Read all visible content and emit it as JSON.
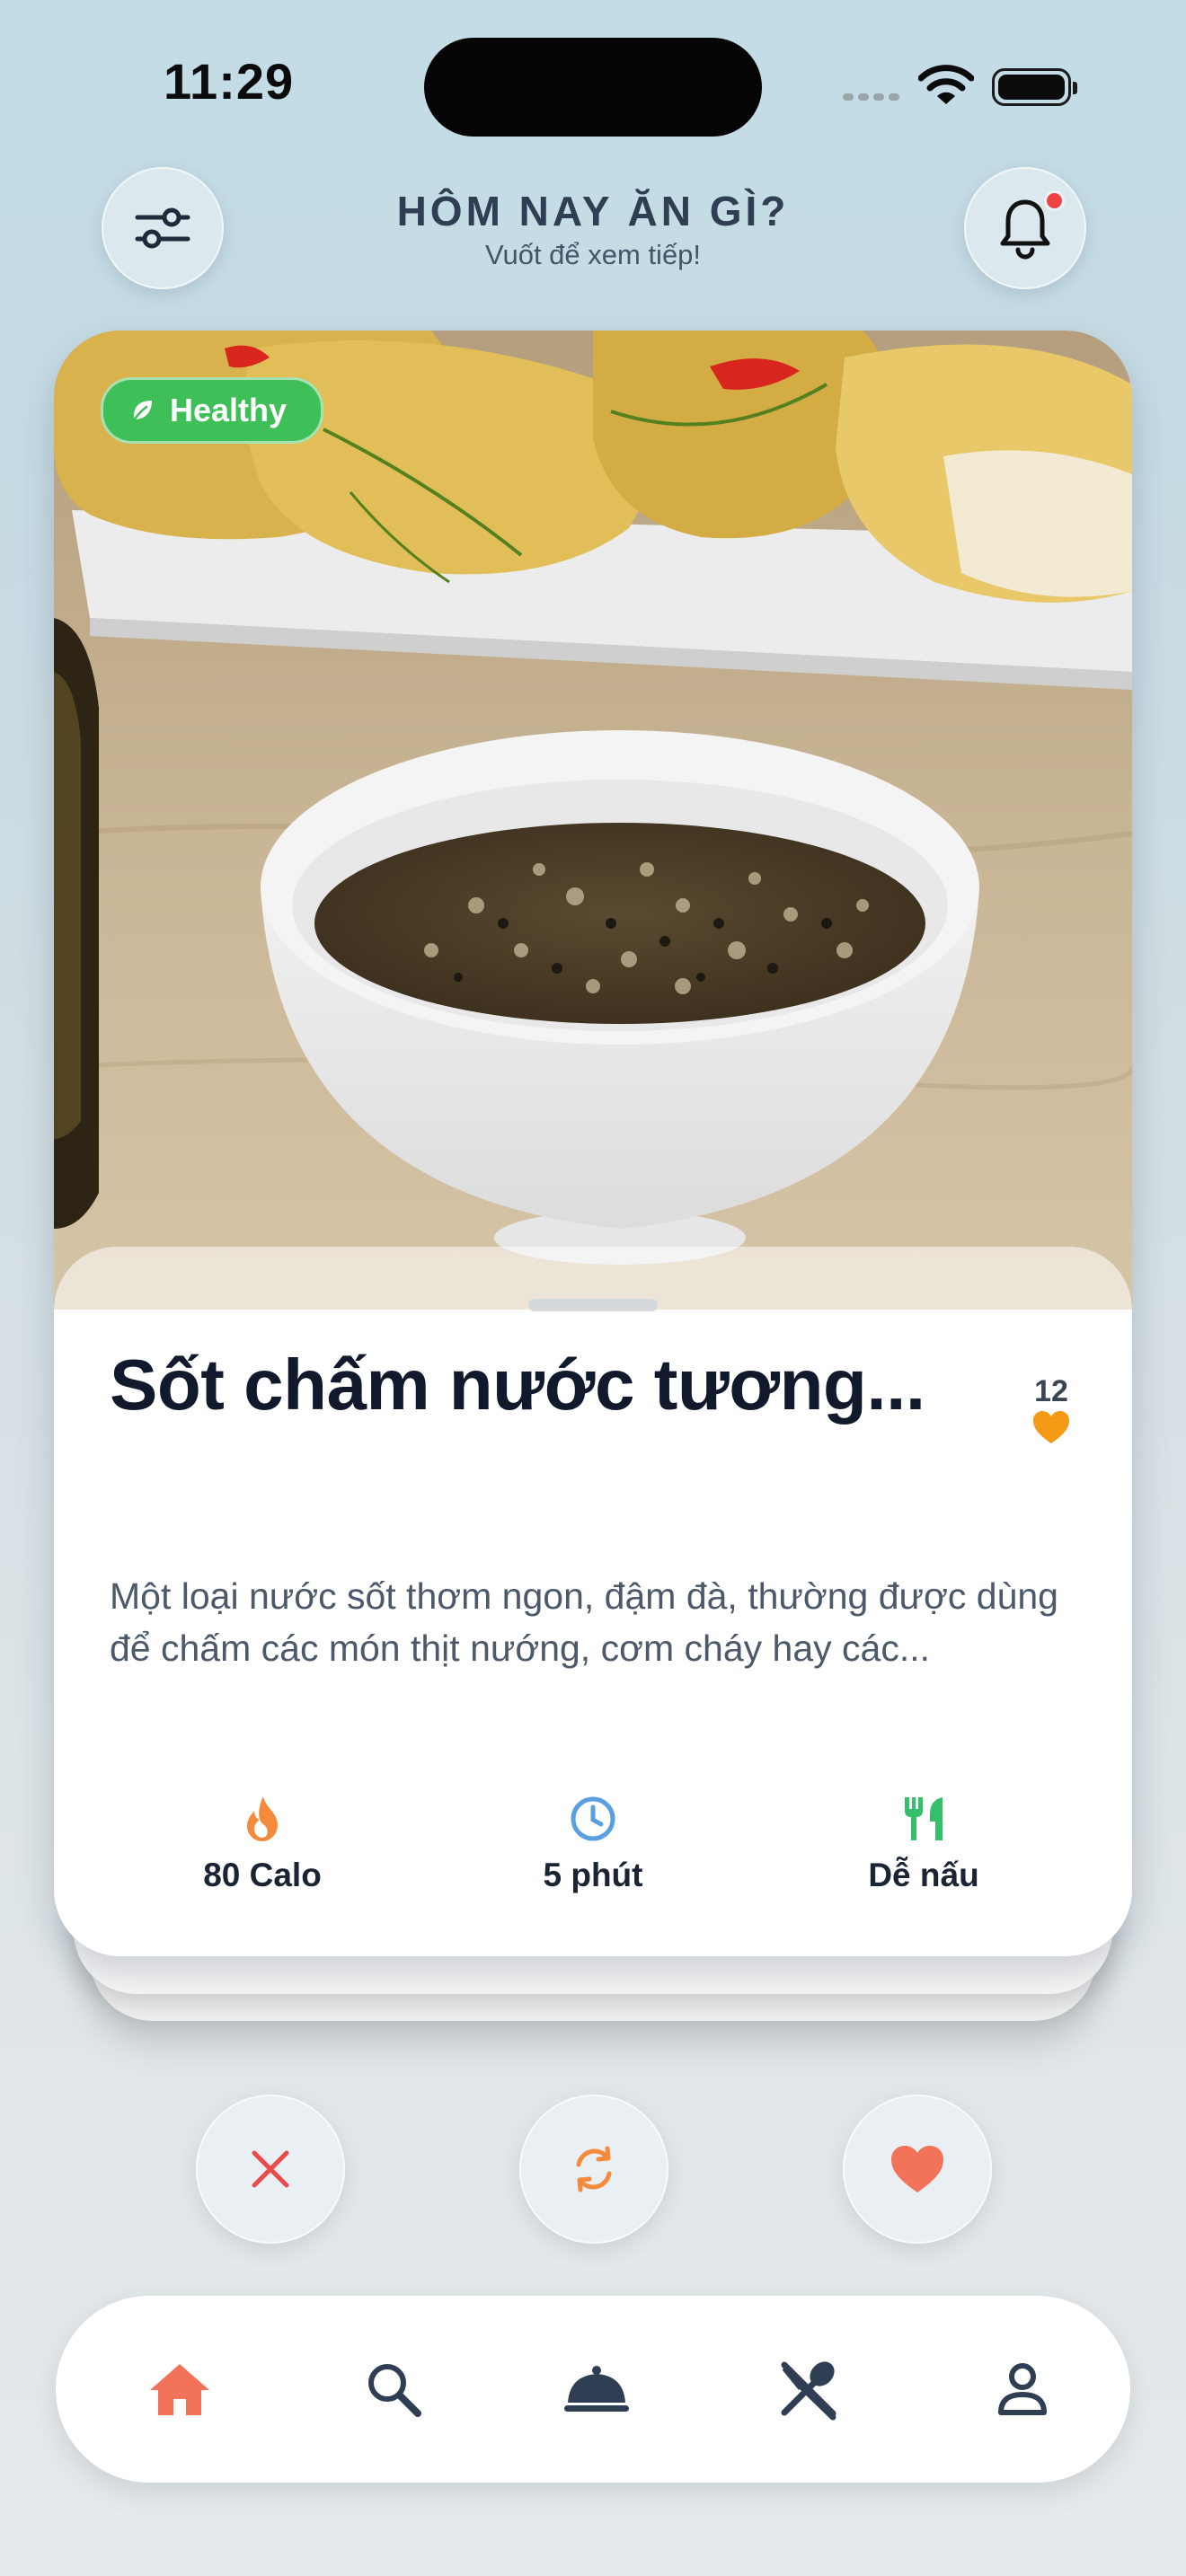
{
  "status_bar": {
    "time": "11:29"
  },
  "header": {
    "title": "HÔM NAY ĂN GÌ?",
    "subtitle": "Vuốt để xem tiếp!",
    "filter_icon": "sliders-icon",
    "notification_icon": "bell-icon",
    "has_unread": true
  },
  "card": {
    "badge": "Healthy",
    "badge_icon": "leaf-icon",
    "name": "Sốt chấm nước tương...",
    "likes": "12",
    "description": "Một loại nước sốt thơm ngon, đậm đà, thường được dùng để chấm các món thịt nướng, cơm cháy hay các...",
    "stats": [
      {
        "icon": "flame-icon",
        "label": "80 Calo",
        "color": "#f58a3c"
      },
      {
        "icon": "clock-icon",
        "label": "5 phút",
        "color": "#5a9fe0"
      },
      {
        "icon": "utensils-icon",
        "label": "Dễ nấu",
        "color": "#34c06a"
      }
    ]
  },
  "actions": [
    {
      "icon": "close-icon",
      "color": "#ea4a4a"
    },
    {
      "icon": "refresh-icon",
      "color": "#f58a3c"
    },
    {
      "icon": "heart-icon",
      "color": "#f2725a"
    }
  ],
  "nav": {
    "active": "home",
    "items": [
      "home-icon",
      "search-icon",
      "cloche-icon",
      "spoon-knife-icon",
      "profile-icon"
    ],
    "active_color": "#f2725a",
    "inactive_color": "#2f3e52"
  }
}
